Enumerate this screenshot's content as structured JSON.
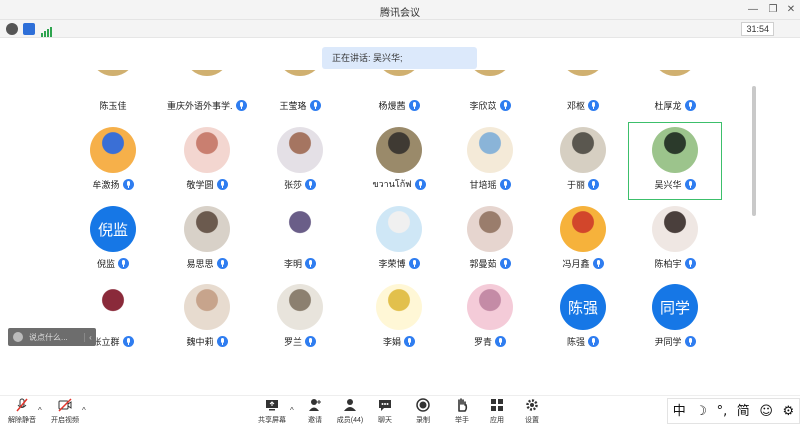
{
  "window": {
    "title": "腾讯会议"
  },
  "status": {
    "timer": "31:54"
  },
  "speaking": {
    "label": "正在讲话: 吴兴华;"
  },
  "chat": {
    "placeholder": "说点什么..."
  },
  "participants_top": [
    {
      "name": "陈玉佳",
      "mic": false
    },
    {
      "name": "重庆外语外事学...",
      "mic": true
    },
    {
      "name": "王莹珞",
      "mic": true
    },
    {
      "name": "杨熳茜",
      "mic": true
    },
    {
      "name": "李欣苡",
      "mic": true
    },
    {
      "name": "邓枢",
      "mic": true
    },
    {
      "name": "杜厚龙",
      "mic": true
    }
  ],
  "participants_row1": [
    {
      "name": "牟激扬",
      "avatar": "pic",
      "colors": [
        "#f6b04a",
        "#3a6fd6"
      ]
    },
    {
      "name": "敬学圆",
      "avatar": "pic",
      "colors": [
        "#f3d6d0",
        "#c97f70"
      ]
    },
    {
      "name": "张莎",
      "avatar": "pic",
      "colors": [
        "#e4e0e6",
        "#a57561"
      ]
    },
    {
      "name": "ขวานโก้ฟ",
      "avatar": "pic",
      "colors": [
        "#9a8a6a",
        "#3f3a33"
      ]
    },
    {
      "name": "甘培瑶",
      "avatar": "pic",
      "colors": [
        "#f4ead8",
        "#8ab4d8"
      ]
    },
    {
      "name": "于丽",
      "avatar": "pic",
      "colors": [
        "#d6cfc2",
        "#5a574f"
      ]
    },
    {
      "name": "吴兴华",
      "avatar": "pic",
      "colors": [
        "#9cc48c",
        "#2b3a2b"
      ]
    }
  ],
  "participants_row2": [
    {
      "name": "倪监",
      "avatar": "text",
      "text": "倪监"
    },
    {
      "name": "易思思",
      "avatar": "pic",
      "colors": [
        "#d8d1c8",
        "#6b5a4e"
      ]
    },
    {
      "name": "李明",
      "avatar": "pic",
      "colors": [
        "#ffffff",
        "#6a5e88"
      ]
    },
    {
      "name": "李荣博",
      "avatar": "pic",
      "colors": [
        "#cfe7f6",
        "#f0f0f0"
      ]
    },
    {
      "name": "郭曼茹",
      "avatar": "pic",
      "colors": [
        "#e6d5cf",
        "#9a7d6c"
      ]
    },
    {
      "name": "冯月鑫",
      "avatar": "pic",
      "colors": [
        "#f6b23b",
        "#d2462b"
      ]
    },
    {
      "name": "陈柏宇",
      "avatar": "pic",
      "colors": [
        "#efe7e3",
        "#4a3f3c"
      ]
    }
  ],
  "participants_row3": [
    {
      "name": "张立群",
      "avatar": "pic",
      "colors": [
        "#ffffff",
        "#8a2a3a"
      ]
    },
    {
      "name": "魏中莉",
      "avatar": "pic",
      "colors": [
        "#e7dbcf",
        "#c7a48c"
      ]
    },
    {
      "name": "罗兰",
      "avatar": "pic",
      "colors": [
        "#e8e4dc",
        "#8c8070"
      ]
    },
    {
      "name": "李娟",
      "avatar": "pic",
      "colors": [
        "#fff7d6",
        "#e2c04c"
      ]
    },
    {
      "name": "罗青",
      "avatar": "pic",
      "colors": [
        "#f4cbd8",
        "#c48ba6"
      ]
    },
    {
      "name": "陈强",
      "avatar": "text",
      "text": "陈强"
    },
    {
      "name": "尹同学",
      "avatar": "text",
      "text": "同学"
    }
  ],
  "toolbar": {
    "unmute": "解除静音",
    "video": "开启视频",
    "share": "共享屏幕",
    "invite": "邀请",
    "members": "成员(44)",
    "chat": "聊天",
    "record": "录制",
    "hand": "举手",
    "apps": "应用",
    "settings": "设置"
  },
  "ime": {
    "lang": "中",
    "moon": "☽",
    "punct": "°,",
    "simp": "简",
    "emoji": "☺",
    "gear": "⚙"
  },
  "colors": {
    "accent": "#1677e6",
    "active_border": "#3cbf6b",
    "banner": "#dce9fb"
  }
}
